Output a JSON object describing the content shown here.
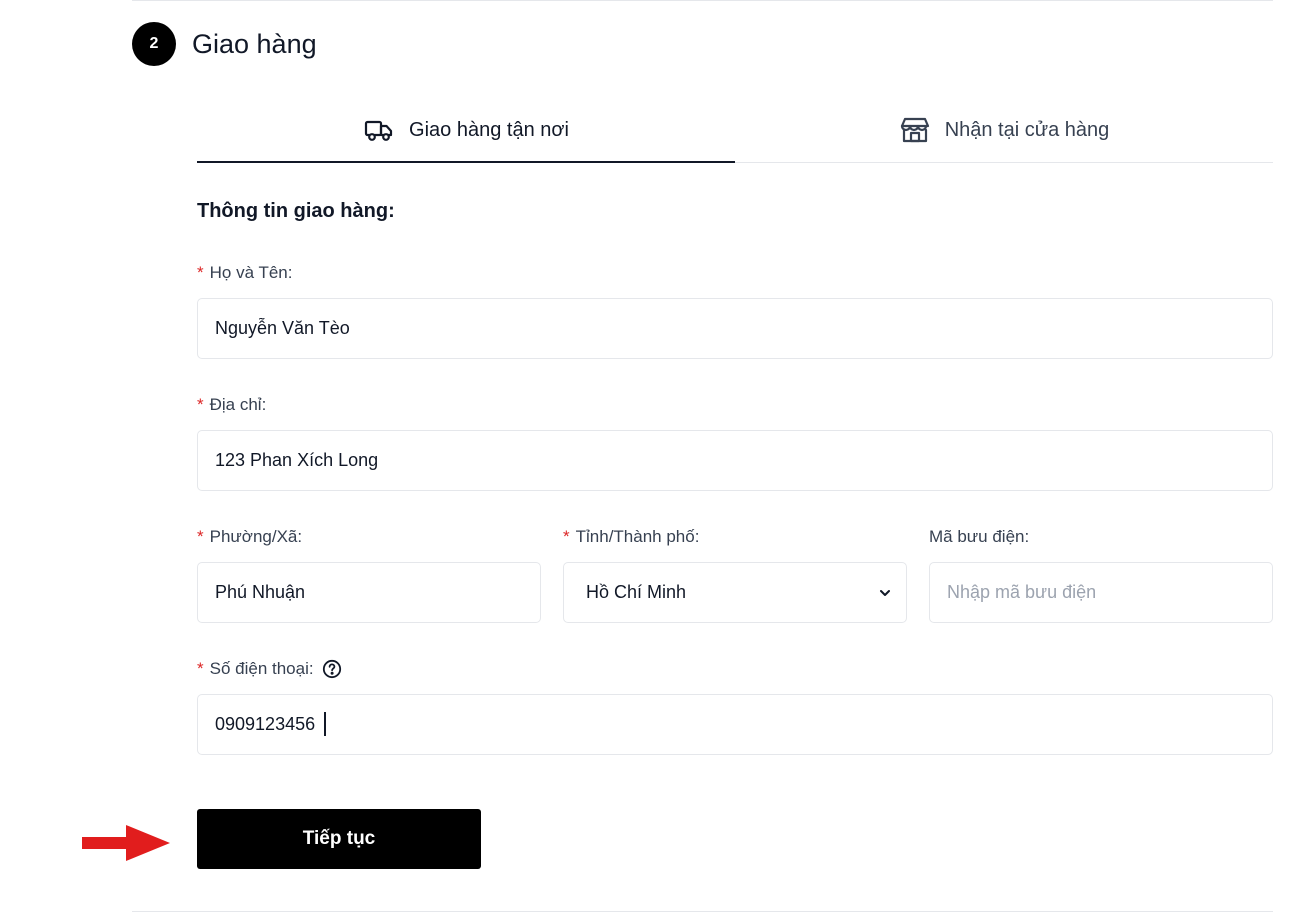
{
  "step": {
    "number": "2",
    "title": "Giao hàng"
  },
  "tabs": [
    {
      "label": "Giao hàng tận nơi",
      "icon": "truck-icon",
      "active": true
    },
    {
      "label": "Nhận tại cửa hàng",
      "icon": "store-icon",
      "active": false
    }
  ],
  "form": {
    "heading": "Thông tin giao hàng:",
    "required_mark": "*",
    "full_name": {
      "label": "Họ và Tên:",
      "value": "Nguyễn Văn Tèo"
    },
    "address": {
      "label": "Địa chỉ:",
      "value": "123 Phan Xích Long"
    },
    "ward": {
      "label": "Phường/Xã:",
      "value": "Phú Nhuận"
    },
    "province": {
      "label": "Tỉnh/Thành phố:",
      "value": "Hồ Chí Minh"
    },
    "postal_code": {
      "label": "Mã bưu điện:",
      "value": "",
      "placeholder": "Nhập mã bưu điện"
    },
    "phone": {
      "label": "Số điện thoại:",
      "value": "0909123456",
      "help_icon": "question-circle-icon"
    }
  },
  "continue_button": {
    "label": "Tiếp tục"
  },
  "colors": {
    "required": "#dc2626",
    "button_bg": "#000000",
    "arrow": "#e11d1d",
    "border": "#e5e7eb"
  }
}
